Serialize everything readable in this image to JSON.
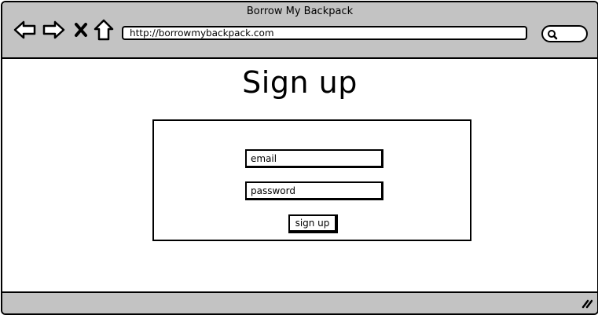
{
  "window": {
    "title": "Borrow My Backpack"
  },
  "toolbar": {
    "icons": [
      "back-arrow-icon",
      "forward-arrow-icon",
      "close-x-icon",
      "home-icon",
      "search-icon"
    ],
    "url": "http://borrowmybackpack.com"
  },
  "page": {
    "title": "Sign up",
    "form": {
      "email_placeholder": "email",
      "password_placeholder": "password",
      "submit_label": "sign up"
    }
  },
  "colors": {
    "chrome": "#c3c3c3",
    "stroke": "#000000",
    "background": "#ffffff"
  }
}
